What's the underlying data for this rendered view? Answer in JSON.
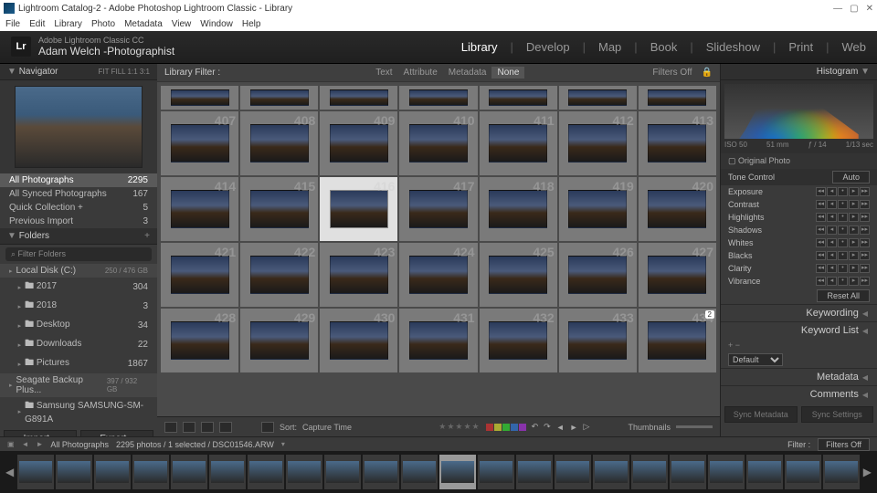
{
  "titlebar": {
    "text": "Lightroom Catalog-2 - Adobe Photoshop Lightroom Classic - Library"
  },
  "menubar": [
    "File",
    "Edit",
    "Library",
    "Photo",
    "Metadata",
    "View",
    "Window",
    "Help"
  ],
  "brand": {
    "logo": "Lr",
    "line1": "Adobe Lightroom Classic CC",
    "line2": "Adam Welch -Photographist"
  },
  "modules": [
    {
      "label": "Library",
      "active": true
    },
    {
      "label": "Develop"
    },
    {
      "label": "Map"
    },
    {
      "label": "Book"
    },
    {
      "label": "Slideshow"
    },
    {
      "label": "Print"
    },
    {
      "label": "Web"
    }
  ],
  "navigator": {
    "title": "Navigator",
    "mode": "FIT  FILL  1:1   3:1"
  },
  "catalog": [
    {
      "label": "All Photographs",
      "count": "2295",
      "sel": true
    },
    {
      "label": "All Synced Photographs",
      "count": "167"
    },
    {
      "label": "Quick Collection  +",
      "count": "5"
    },
    {
      "label": "Previous Import",
      "count": "3"
    }
  ],
  "folders": {
    "title": "Folders",
    "filter": "Filter Folders",
    "disks": [
      {
        "name": "Local Disk (C:)",
        "stat": "250 / 476 GB",
        "items": [
          {
            "name": "2017",
            "count": "304"
          },
          {
            "name": "2018",
            "count": "3"
          },
          {
            "name": "Desktop",
            "count": "34"
          },
          {
            "name": "Downloads",
            "count": "22"
          },
          {
            "name": "Pictures",
            "count": "1867"
          }
        ]
      },
      {
        "name": "Seagate Backup Plus...",
        "stat": "397 / 932 GB",
        "items": [
          {
            "name": "Samsung SAMSUNG-SM-G891A",
            "count": ""
          }
        ]
      }
    ]
  },
  "buttons": {
    "import": "Import...",
    "export": "Export..."
  },
  "filterbar": {
    "label": "Library Filter :",
    "opts": [
      "Text",
      "Attribute",
      "Metadata",
      "None"
    ],
    "sel": "None",
    "filters_off": "Filters Off"
  },
  "grid": {
    "start": 407,
    "rows": 5,
    "cols": 7,
    "selected": 416,
    "badge": {
      "index": 434,
      "text": "2"
    }
  },
  "toolbar": {
    "sort_label": "Sort:",
    "sort_value": "Capture Time",
    "thumbs": "Thumbnails"
  },
  "right": {
    "histogram": {
      "title": "Histogram",
      "iso": "ISO 50",
      "focal": "51 mm",
      "aperture": "ƒ / 14",
      "shutter": "1/13 sec"
    },
    "original": "Original Photo",
    "tone": {
      "title": "Tone Control",
      "auto": "Auto",
      "items": [
        "Exposure",
        "Contrast",
        "Highlights",
        "Shadows",
        "Whites",
        "Blacks",
        "Clarity",
        "Vibrance"
      ],
      "reset": "Reset All"
    },
    "panels": [
      "Keywording",
      "Keyword List",
      "Metadata",
      "Comments"
    ],
    "meta_preset": "Default",
    "sync": {
      "meta": "Sync Metadata",
      "settings": "Sync Settings"
    }
  },
  "status": {
    "source": "All Photographs",
    "info": "2295 photos / 1 selected / DSC01546.ARW",
    "filter": "Filter :",
    "filters_off": "Filters Off"
  },
  "filmstrip": {
    "count": 22,
    "selected": 11
  }
}
